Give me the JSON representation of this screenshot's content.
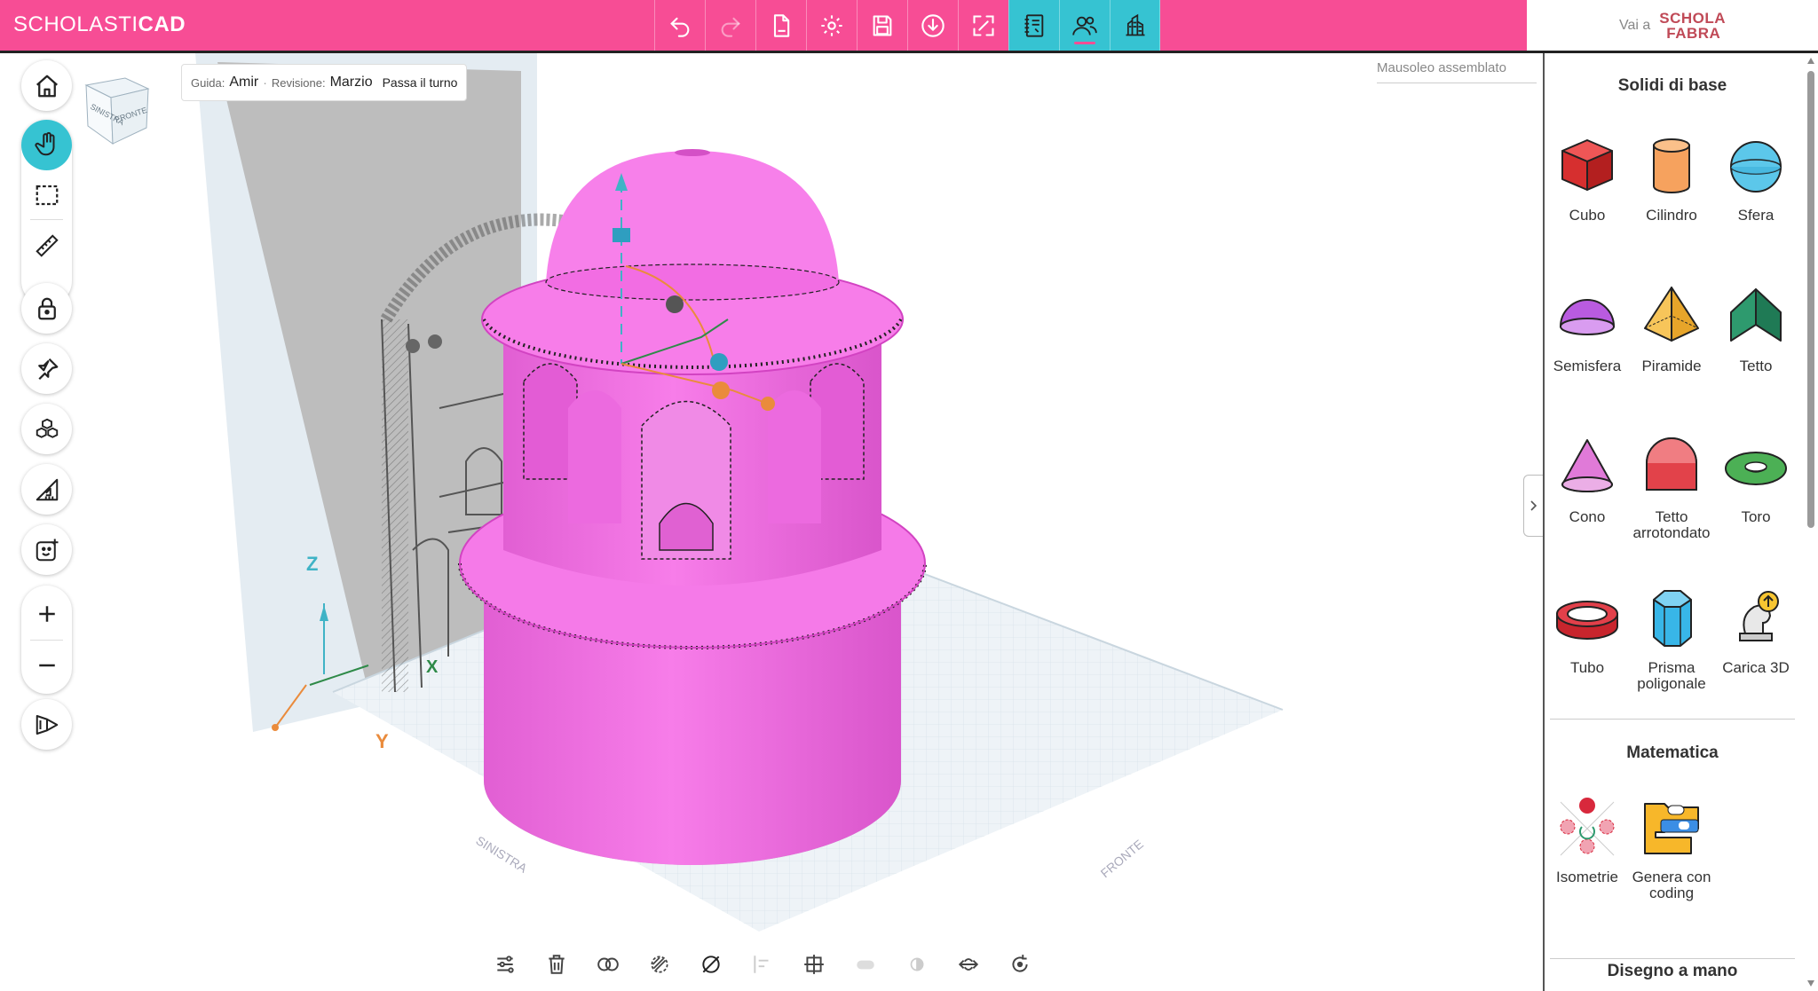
{
  "app": {
    "brand_light": "SCHOLASTI",
    "brand_bold": "CAD",
    "fabra_label": "Vai a",
    "fabra_logo_top": "SCHOLA",
    "fabra_logo_bottom": "FABRA"
  },
  "toolbar": [
    {
      "name": "undo-icon"
    },
    {
      "name": "redo-icon"
    },
    {
      "name": "new-file-icon"
    },
    {
      "name": "settings-icon"
    },
    {
      "name": "save-icon"
    },
    {
      "name": "download-icon"
    },
    {
      "name": "fullscreen-icon"
    },
    {
      "name": "notebook-icon"
    },
    {
      "name": "collaborators-icon"
    },
    {
      "name": "scene-icon"
    }
  ],
  "guide": {
    "guide_label": "Guida:",
    "guide_value": "Amir",
    "separator": "·",
    "revision_label": "Revisione:",
    "revision_value": "Marzio",
    "pass_turn": "Passa il turno"
  },
  "project_name": "Mausoleo assemblato",
  "viewcube": {
    "left": "SINISTRA",
    "front": "FRONTE"
  },
  "axes": {
    "z": "Z",
    "x": "X",
    "y": "Y"
  },
  "floor_labels": {
    "left": "SINISTRA",
    "front": "FRONTE"
  },
  "panel": {
    "section_basic": "Solidi di base",
    "shapes": [
      {
        "label": "Cubo",
        "icon": "cube-icon"
      },
      {
        "label": "Cilindro",
        "icon": "cylinder-icon"
      },
      {
        "label": "Sfera",
        "icon": "sphere-icon"
      },
      {
        "label": "Semisfera",
        "icon": "hemisphere-icon"
      },
      {
        "label": "Piramide",
        "icon": "pyramid-icon"
      },
      {
        "label": "Tetto",
        "icon": "roof-icon"
      },
      {
        "label": "Cono",
        "icon": "cone-icon"
      },
      {
        "label": "Tetto arrotondato",
        "icon": "rounded-roof-icon"
      },
      {
        "label": "Toro",
        "icon": "torus-icon"
      },
      {
        "label": "Tubo",
        "icon": "tube-icon"
      },
      {
        "label": "Prisma poligonale",
        "icon": "polygonal-prism-icon"
      },
      {
        "label": "Carica 3D",
        "icon": "upload-3d-icon"
      }
    ],
    "section_math": "Matematica",
    "math": [
      {
        "label": "Isometrie",
        "icon": "isometry-icon"
      },
      {
        "label": "Genera con coding",
        "icon": "coding-icon"
      }
    ],
    "section_draw": "Disegno a mano"
  },
  "colors": {
    "topbar": "#f74d95",
    "accent": "#36c3d2",
    "model": "#f572e6"
  }
}
